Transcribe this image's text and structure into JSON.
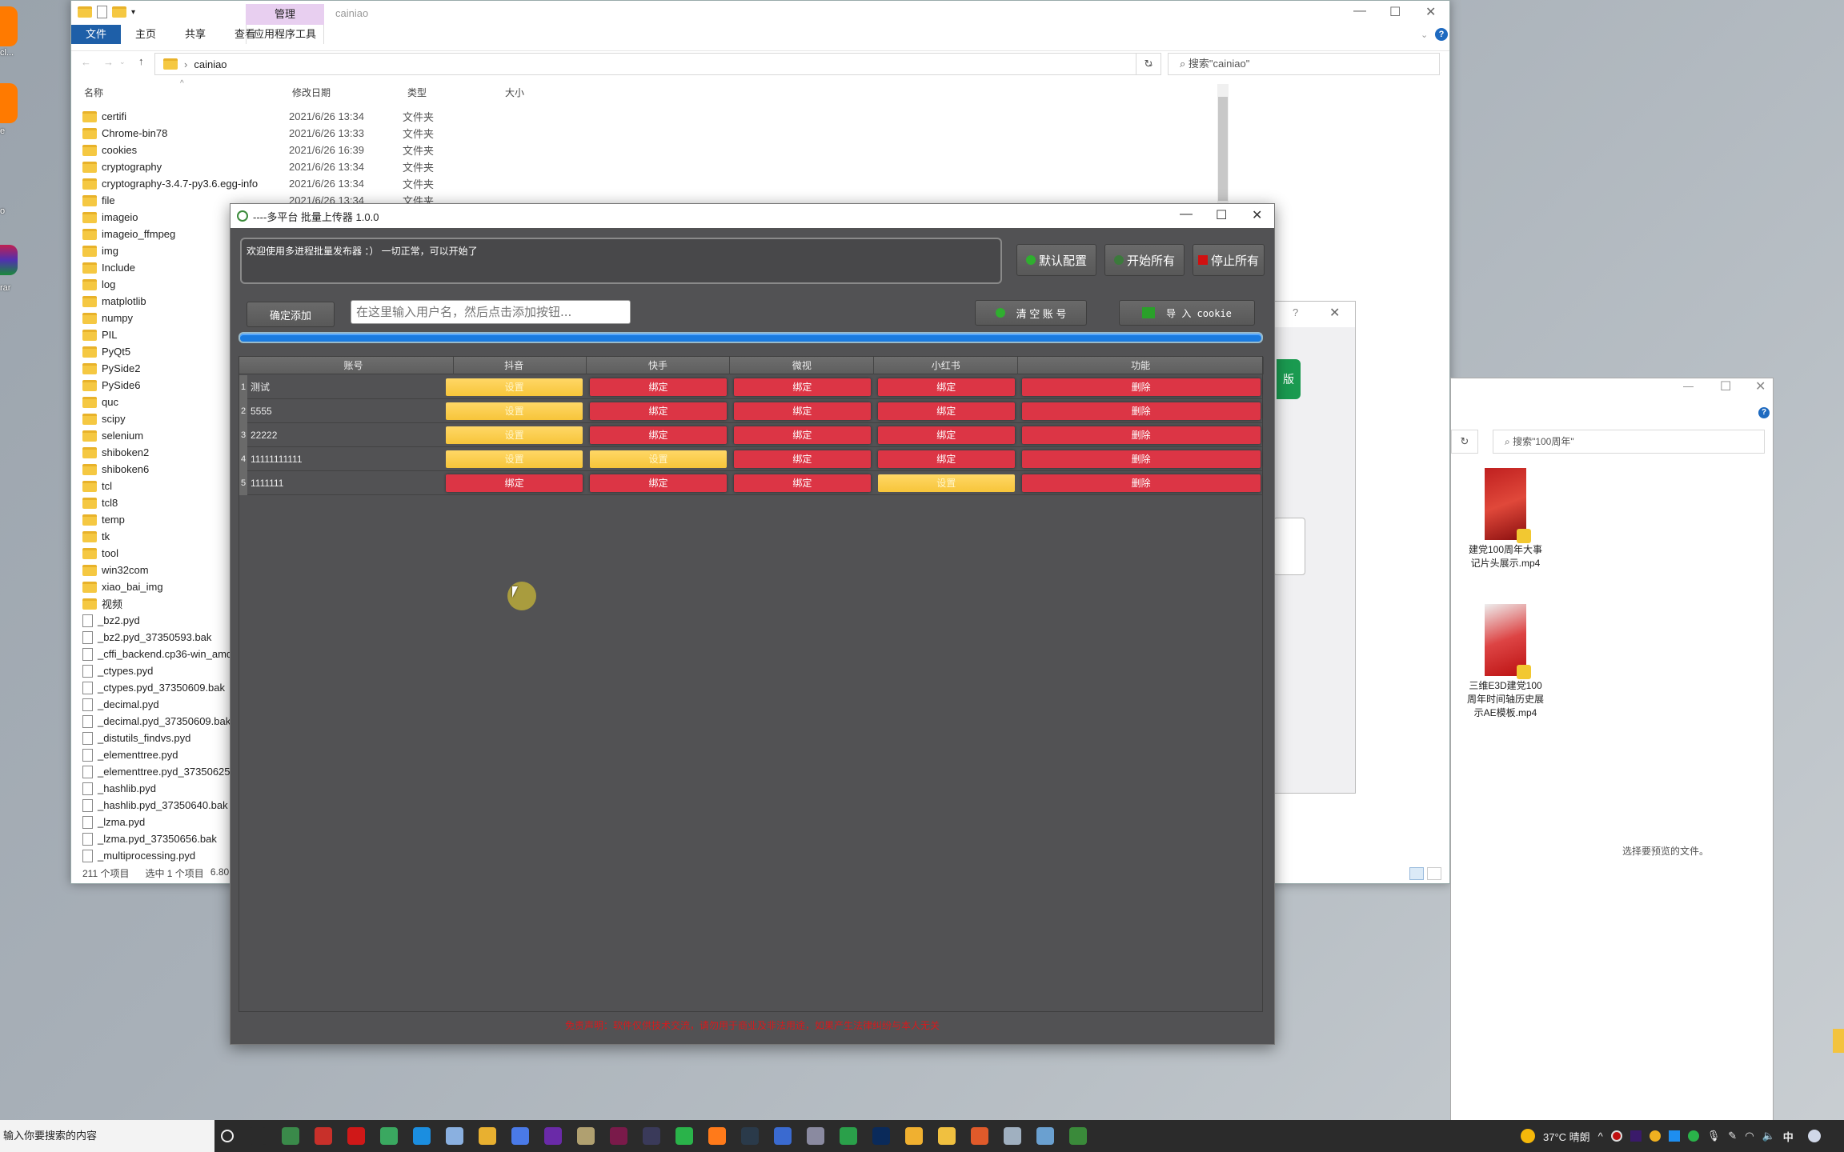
{
  "desktop": {
    "left_icons": [
      {
        "label": "cl...",
        "color": "#ff7a00"
      },
      {
        "label": "e",
        "color": "#ff7a00"
      },
      {
        "label": "o",
        "color": ""
      },
      {
        "label": "rar",
        "color": "#a0256a"
      }
    ]
  },
  "explorer": {
    "title": "cainiao",
    "manage_tab": "管理",
    "app_tools_tab": "应用程序工具",
    "ribbon_tabs": [
      "文件",
      "主页",
      "共享",
      "查看"
    ],
    "address_path": "cainiao",
    "search_placeholder": "搜索\"cainiao\"",
    "columns": {
      "name": "名称",
      "modified": "修改日期",
      "type": "类型",
      "size": "大小"
    },
    "files": [
      {
        "name": "certifi",
        "date": "2021/6/26 13:34",
        "type": "文件夹",
        "kind": "folder"
      },
      {
        "name": "Chrome-bin78",
        "date": "2021/6/26 13:33",
        "type": "文件夹",
        "kind": "folder"
      },
      {
        "name": "cookies",
        "date": "2021/6/26 16:39",
        "type": "文件夹",
        "kind": "folder"
      },
      {
        "name": "cryptography",
        "date": "2021/6/26 13:34",
        "type": "文件夹",
        "kind": "folder"
      },
      {
        "name": "cryptography-3.4.7-py3.6.egg-info",
        "date": "2021/6/26 13:34",
        "type": "文件夹",
        "kind": "folder"
      },
      {
        "name": "file",
        "date": "2021/6/26 13:34",
        "type": "文件夹",
        "kind": "folder"
      },
      {
        "name": "imageio",
        "date": "",
        "type": "",
        "kind": "folder"
      },
      {
        "name": "imageio_ffmpeg",
        "date": "",
        "type": "",
        "kind": "folder"
      },
      {
        "name": "img",
        "date": "",
        "type": "",
        "kind": "folder"
      },
      {
        "name": "Include",
        "date": "",
        "type": "",
        "kind": "folder"
      },
      {
        "name": "log",
        "date": "",
        "type": "",
        "kind": "folder"
      },
      {
        "name": "matplotlib",
        "date": "",
        "type": "",
        "kind": "folder"
      },
      {
        "name": "numpy",
        "date": "",
        "type": "",
        "kind": "folder"
      },
      {
        "name": "PIL",
        "date": "",
        "type": "",
        "kind": "folder"
      },
      {
        "name": "PyQt5",
        "date": "",
        "type": "",
        "kind": "folder"
      },
      {
        "name": "PySide2",
        "date": "",
        "type": "",
        "kind": "folder"
      },
      {
        "name": "PySide6",
        "date": "",
        "type": "",
        "kind": "folder"
      },
      {
        "name": "quc",
        "date": "",
        "type": "",
        "kind": "folder"
      },
      {
        "name": "scipy",
        "date": "",
        "type": "",
        "kind": "folder"
      },
      {
        "name": "selenium",
        "date": "",
        "type": "",
        "kind": "folder"
      },
      {
        "name": "shiboken2",
        "date": "",
        "type": "",
        "kind": "folder"
      },
      {
        "name": "shiboken6",
        "date": "",
        "type": "",
        "kind": "folder"
      },
      {
        "name": "tcl",
        "date": "",
        "type": "",
        "kind": "folder"
      },
      {
        "name": "tcl8",
        "date": "",
        "type": "",
        "kind": "folder"
      },
      {
        "name": "temp",
        "date": "",
        "type": "",
        "kind": "folder"
      },
      {
        "name": "tk",
        "date": "",
        "type": "",
        "kind": "folder"
      },
      {
        "name": "tool",
        "date": "",
        "type": "",
        "kind": "folder"
      },
      {
        "name": "win32com",
        "date": "",
        "type": "",
        "kind": "folder"
      },
      {
        "name": "xiao_bai_img",
        "date": "",
        "type": "",
        "kind": "folder"
      },
      {
        "name": "视频",
        "date": "",
        "type": "",
        "kind": "folder"
      },
      {
        "name": "_bz2.pyd",
        "date": "",
        "type": "",
        "kind": "file"
      },
      {
        "name": "_bz2.pyd_37350593.bak",
        "date": "",
        "type": "",
        "kind": "file"
      },
      {
        "name": "_cffi_backend.cp36-win_amd",
        "date": "",
        "type": "",
        "kind": "file"
      },
      {
        "name": "_ctypes.pyd",
        "date": "",
        "type": "",
        "kind": "file"
      },
      {
        "name": "_ctypes.pyd_37350609.bak",
        "date": "",
        "type": "",
        "kind": "file"
      },
      {
        "name": "_decimal.pyd",
        "date": "",
        "type": "",
        "kind": "file"
      },
      {
        "name": "_decimal.pyd_37350609.bak",
        "date": "",
        "type": "",
        "kind": "file"
      },
      {
        "name": "_distutils_findvs.pyd",
        "date": "",
        "type": "",
        "kind": "file"
      },
      {
        "name": "_elementtree.pyd",
        "date": "",
        "type": "",
        "kind": "file"
      },
      {
        "name": "_elementtree.pyd_37350625.",
        "date": "",
        "type": "",
        "kind": "file"
      },
      {
        "name": "_hashlib.pyd",
        "date": "",
        "type": "",
        "kind": "file"
      },
      {
        "name": "_hashlib.pyd_37350640.bak",
        "date": "",
        "type": "",
        "kind": "file"
      },
      {
        "name": "_lzma.pyd",
        "date": "",
        "type": "",
        "kind": "file"
      },
      {
        "name": "_lzma.pyd_37350656.bak",
        "date": "",
        "type": "",
        "kind": "file"
      },
      {
        "name": "_multiprocessing.pyd",
        "date": "",
        "type": "",
        "kind": "file"
      }
    ],
    "status_count": "211 个项目",
    "status_selected": "选中 1 个项目",
    "status_size": "6.80"
  },
  "dialog2": {
    "help": "?",
    "green_tab_label": "版"
  },
  "explorer3": {
    "search_placeholder": "搜索\"100周年\"",
    "videos": [
      {
        "label": "建党100周年大事记片头展示.mp4"
      },
      {
        "label": "三维E3D建党100周年时间轴历史展示AE模板.mp4"
      }
    ],
    "preview_hint": "选择要预览的文件。"
  },
  "app": {
    "title": "----多平台 批量上传器 1.0.0",
    "log_text": "欢迎使用多进程批量发布器  ：）  一切正常，可以开始了",
    "buttons": {
      "default_config": "默认配置",
      "start_all": "开始所有",
      "stop_all": "停止所有",
      "confirm_add": "确定添加",
      "clear_accounts": "清 空 账 号",
      "import_cookie": "导 入 cookie"
    },
    "user_input_placeholder": "在这里输入用户名，然后点击添加按钮...",
    "progress": 1.0,
    "colors": {
      "bind": "#dc3545",
      "set": "#f7c53a",
      "progress": "#1a7be0"
    },
    "table": {
      "headers": [
        "账号",
        "抖音",
        "快手",
        "微视",
        "小红书",
        "功能"
      ],
      "rows": [
        {
          "index": "1",
          "account": "测试",
          "cells": [
            "设置",
            "绑定",
            "绑定",
            "绑定"
          ],
          "states": [
            "set",
            "bind",
            "bind",
            "bind"
          ],
          "action": "删除"
        },
        {
          "index": "2",
          "account": "5555",
          "cells": [
            "设置",
            "绑定",
            "绑定",
            "绑定"
          ],
          "states": [
            "set",
            "bind",
            "bind",
            "bind"
          ],
          "action": "删除"
        },
        {
          "index": "3",
          "account": "22222",
          "cells": [
            "设置",
            "绑定",
            "绑定",
            "绑定"
          ],
          "states": [
            "set",
            "bind",
            "bind",
            "bind"
          ],
          "action": "删除"
        },
        {
          "index": "4",
          "account": "11111111111",
          "cells": [
            "设置",
            "设置",
            "绑定",
            "绑定"
          ],
          "states": [
            "set",
            "set",
            "bind",
            "bind"
          ],
          "action": "删除"
        },
        {
          "index": "5",
          "account": "1111111",
          "cells": [
            "绑定",
            "绑定",
            "绑定",
            "设置"
          ],
          "states": [
            "bind",
            "bind",
            "bind",
            "set"
          ],
          "action": "删除"
        }
      ]
    },
    "disclaimer": "免责声明：软件仅供技术交流，请勿用于商业及非法用途，如果产生法律纠纷与本人无关"
  },
  "taskbar": {
    "search_placeholder": "输入你要搜索的内容",
    "apps": [
      {
        "name": "cortana-icon",
        "color": "#2b2b2b"
      },
      {
        "name": "task-view-icon",
        "color": "#2b2b2b"
      },
      {
        "name": "app-monitor-icon",
        "color": "#3a8a4a"
      },
      {
        "name": "app-red-green-icon",
        "color": "#c8302a"
      },
      {
        "name": "record-icon",
        "color": "#d01818"
      },
      {
        "name": "panda-icon",
        "color": "#3aa860"
      },
      {
        "name": "app-blue-icon",
        "color": "#1b8ee0"
      },
      {
        "name": "send-icon",
        "color": "#8ab0e0"
      },
      {
        "name": "audio-levels-icon",
        "color": "#e8b030"
      },
      {
        "name": "app-circle-icon",
        "color": "#4a7ae8"
      },
      {
        "name": "app-purple-icon",
        "color": "#6a2aa8"
      },
      {
        "name": "media-player-icon",
        "color": "#b0a070"
      },
      {
        "name": "animate-icon",
        "color": "#7a1a4a"
      },
      {
        "name": "app-diamond-icon",
        "color": "#3a3a5a"
      },
      {
        "name": "wechat-icon",
        "color": "#2ab34a"
      },
      {
        "name": "firefox-icon",
        "color": "#ff7a1a"
      },
      {
        "name": "app-dark-icon",
        "color": "#2a3a4a"
      },
      {
        "name": "ub-icon",
        "color": "#3a6ad0"
      },
      {
        "name": "app-spy-icon",
        "color": "#8a8aa0"
      },
      {
        "name": "app-green-round-icon",
        "color": "#2aa04a"
      },
      {
        "name": "photoshop-icon",
        "color": "#0a2a5a"
      },
      {
        "name": "app-k-icon",
        "color": "#f0b030"
      },
      {
        "name": "file-explorer-icon",
        "color": "#f0c040"
      },
      {
        "name": "app-color-wheel-icon",
        "color": "#e05a2a"
      },
      {
        "name": "app-chart-icon",
        "color": "#a0b0c0"
      },
      {
        "name": "notepad-icon",
        "color": "#6aa0d0"
      },
      {
        "name": "uploader-app-icon",
        "color": "#3a8a3a"
      }
    ],
    "weather": "37°C 晴朗",
    "ime": "中"
  }
}
